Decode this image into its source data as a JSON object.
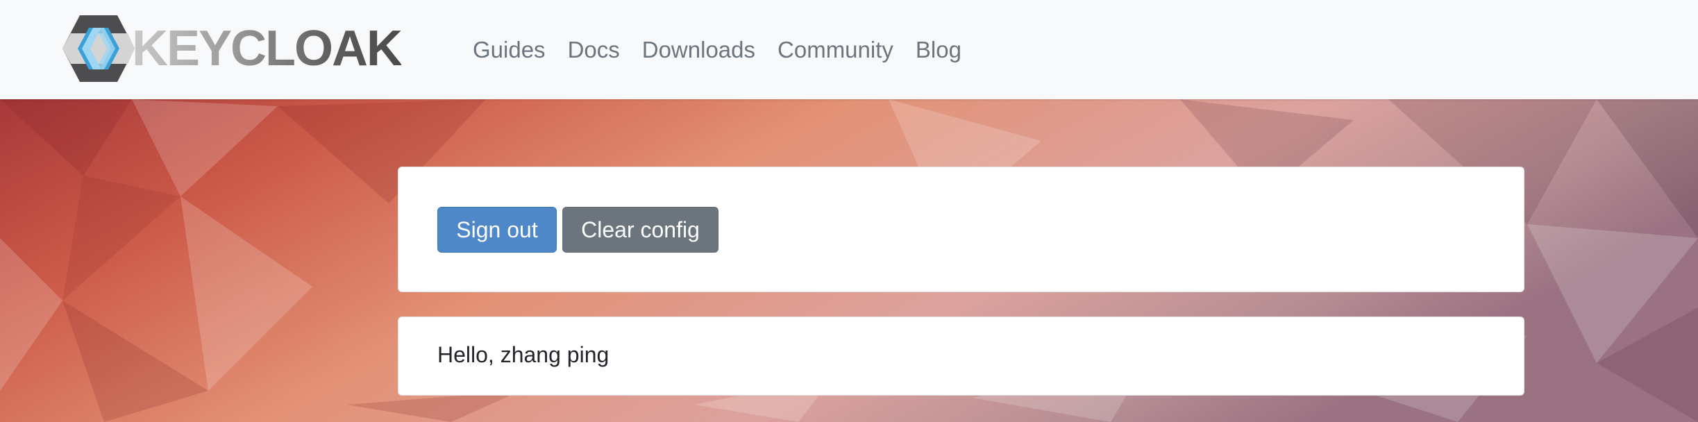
{
  "brand": {
    "name": "KEYCLOAK",
    "logo_icon": "keycloak-hexagon-icon",
    "colors": {
      "hex_dark": "#4d4d4f",
      "diamond_blue": "#4fb3e3",
      "diamond_light": "#bfe3f5"
    }
  },
  "nav": {
    "items": [
      {
        "label": "Guides"
      },
      {
        "label": "Docs"
      },
      {
        "label": "Downloads"
      },
      {
        "label": "Community"
      },
      {
        "label": "Blog"
      }
    ]
  },
  "actions": {
    "sign_out_label": "Sign out",
    "clear_config_label": "Clear config"
  },
  "greeting": {
    "text": "Hello, zhang ping"
  },
  "theme": {
    "header_bg": "#f8f9fa",
    "nav_text": "#6c757d",
    "primary": "#4f88c8",
    "secondary": "#6c757d",
    "background_palette": [
      "#a83a3a",
      "#d9694e",
      "#e89a7f",
      "#cfa3a8",
      "#9a7080"
    ]
  }
}
